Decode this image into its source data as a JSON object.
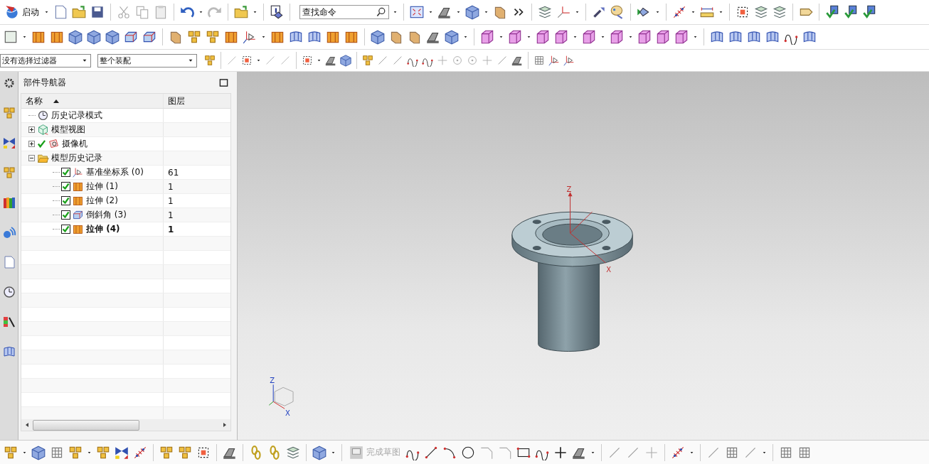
{
  "toolbar": {
    "start_button": {
      "label": "启动"
    },
    "search": {
      "placeholder": "查找命令"
    }
  },
  "selection_bar": {
    "filter": {
      "value": "没有选择过滤器"
    },
    "scope": {
      "value": "整个装配"
    }
  },
  "navigator": {
    "title": "部件导航器",
    "columns": [
      {
        "label": "名称",
        "sorted": true
      },
      {
        "label": "图层",
        "sorted": false
      }
    ],
    "tree": [
      {
        "label": "历史记录模式",
        "kind": "mode"
      },
      {
        "label": "模型视图",
        "kind": "view",
        "expanded": false
      },
      {
        "label": "摄像机",
        "kind": "camera",
        "expanded": false,
        "active": true
      },
      {
        "label": "模型历史记录",
        "kind": "group",
        "expanded": true,
        "children": [
          {
            "label": "基准坐标系 (0)",
            "kind": "datum",
            "checked": true,
            "layer": "61",
            "current": false
          },
          {
            "label": "拉伸 (1)",
            "kind": "extrude",
            "checked": true,
            "layer": "1",
            "current": false
          },
          {
            "label": "拉伸 (2)",
            "kind": "extrude",
            "checked": true,
            "layer": "1",
            "current": false
          },
          {
            "label": "倒斜角 (3)",
            "kind": "chamfer",
            "checked": true,
            "layer": "1",
            "current": false
          },
          {
            "label": "拉伸 (4)",
            "kind": "extrude",
            "checked": true,
            "layer": "1",
            "current": true
          }
        ]
      }
    ]
  },
  "viewport": {
    "csys_labels": [
      "Z",
      "X"
    ],
    "triad_labels": [
      "Z",
      "X"
    ]
  },
  "bottom_toolbar": {
    "finish_sketch": {
      "label": "完成草图",
      "disabled": true
    }
  }
}
